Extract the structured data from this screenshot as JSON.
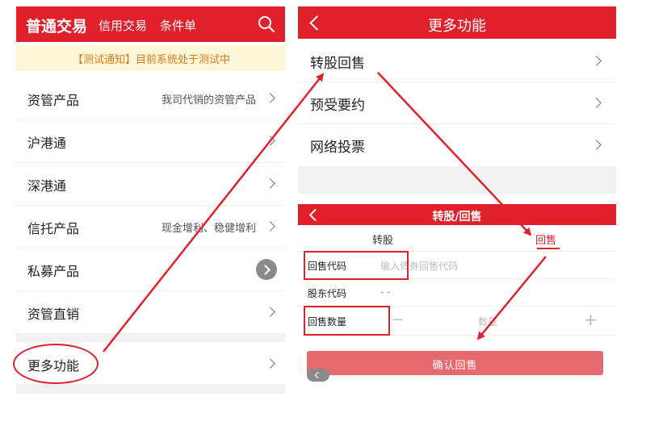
{
  "left_screen": {
    "tabs": [
      "普通交易",
      "信用交易",
      "条件单"
    ],
    "search_icon": "search-icon",
    "notice": "【测试通知】目前系统处于测试中",
    "menu": [
      {
        "label": "资管产品",
        "desc": "我司代销的资管产品"
      },
      {
        "label": "沪港通",
        "desc": ""
      },
      {
        "label": "深港通",
        "desc": ""
      },
      {
        "label": "信托产品",
        "desc": "现金增利、稳健增利"
      },
      {
        "label": "私募产品",
        "desc": ""
      },
      {
        "label": "资管直销",
        "desc": ""
      }
    ],
    "more": "更多功能"
  },
  "right_top": {
    "title": "更多功能",
    "items": [
      "转股回售",
      "预受要约",
      "网络投票"
    ]
  },
  "right_bottom": {
    "title": "转股/回售",
    "tabs": [
      "转股",
      "回售"
    ],
    "active_tab": "回售",
    "fields": {
      "code_label": "回售代码",
      "code_placeholder": "输入债券回售代码",
      "holder_label": "股东代码",
      "holder_value": "- -",
      "qty_label": "回售数量",
      "qty_minus": "−",
      "qty_placeholder": "数量",
      "qty_plus": "+"
    },
    "confirm": "确认回售"
  },
  "colors": {
    "brand": "#e0202a",
    "notice_bg": "#fdf6d9",
    "notice_text": "#e07b1a",
    "confirm_bg": "#e46a6e"
  }
}
